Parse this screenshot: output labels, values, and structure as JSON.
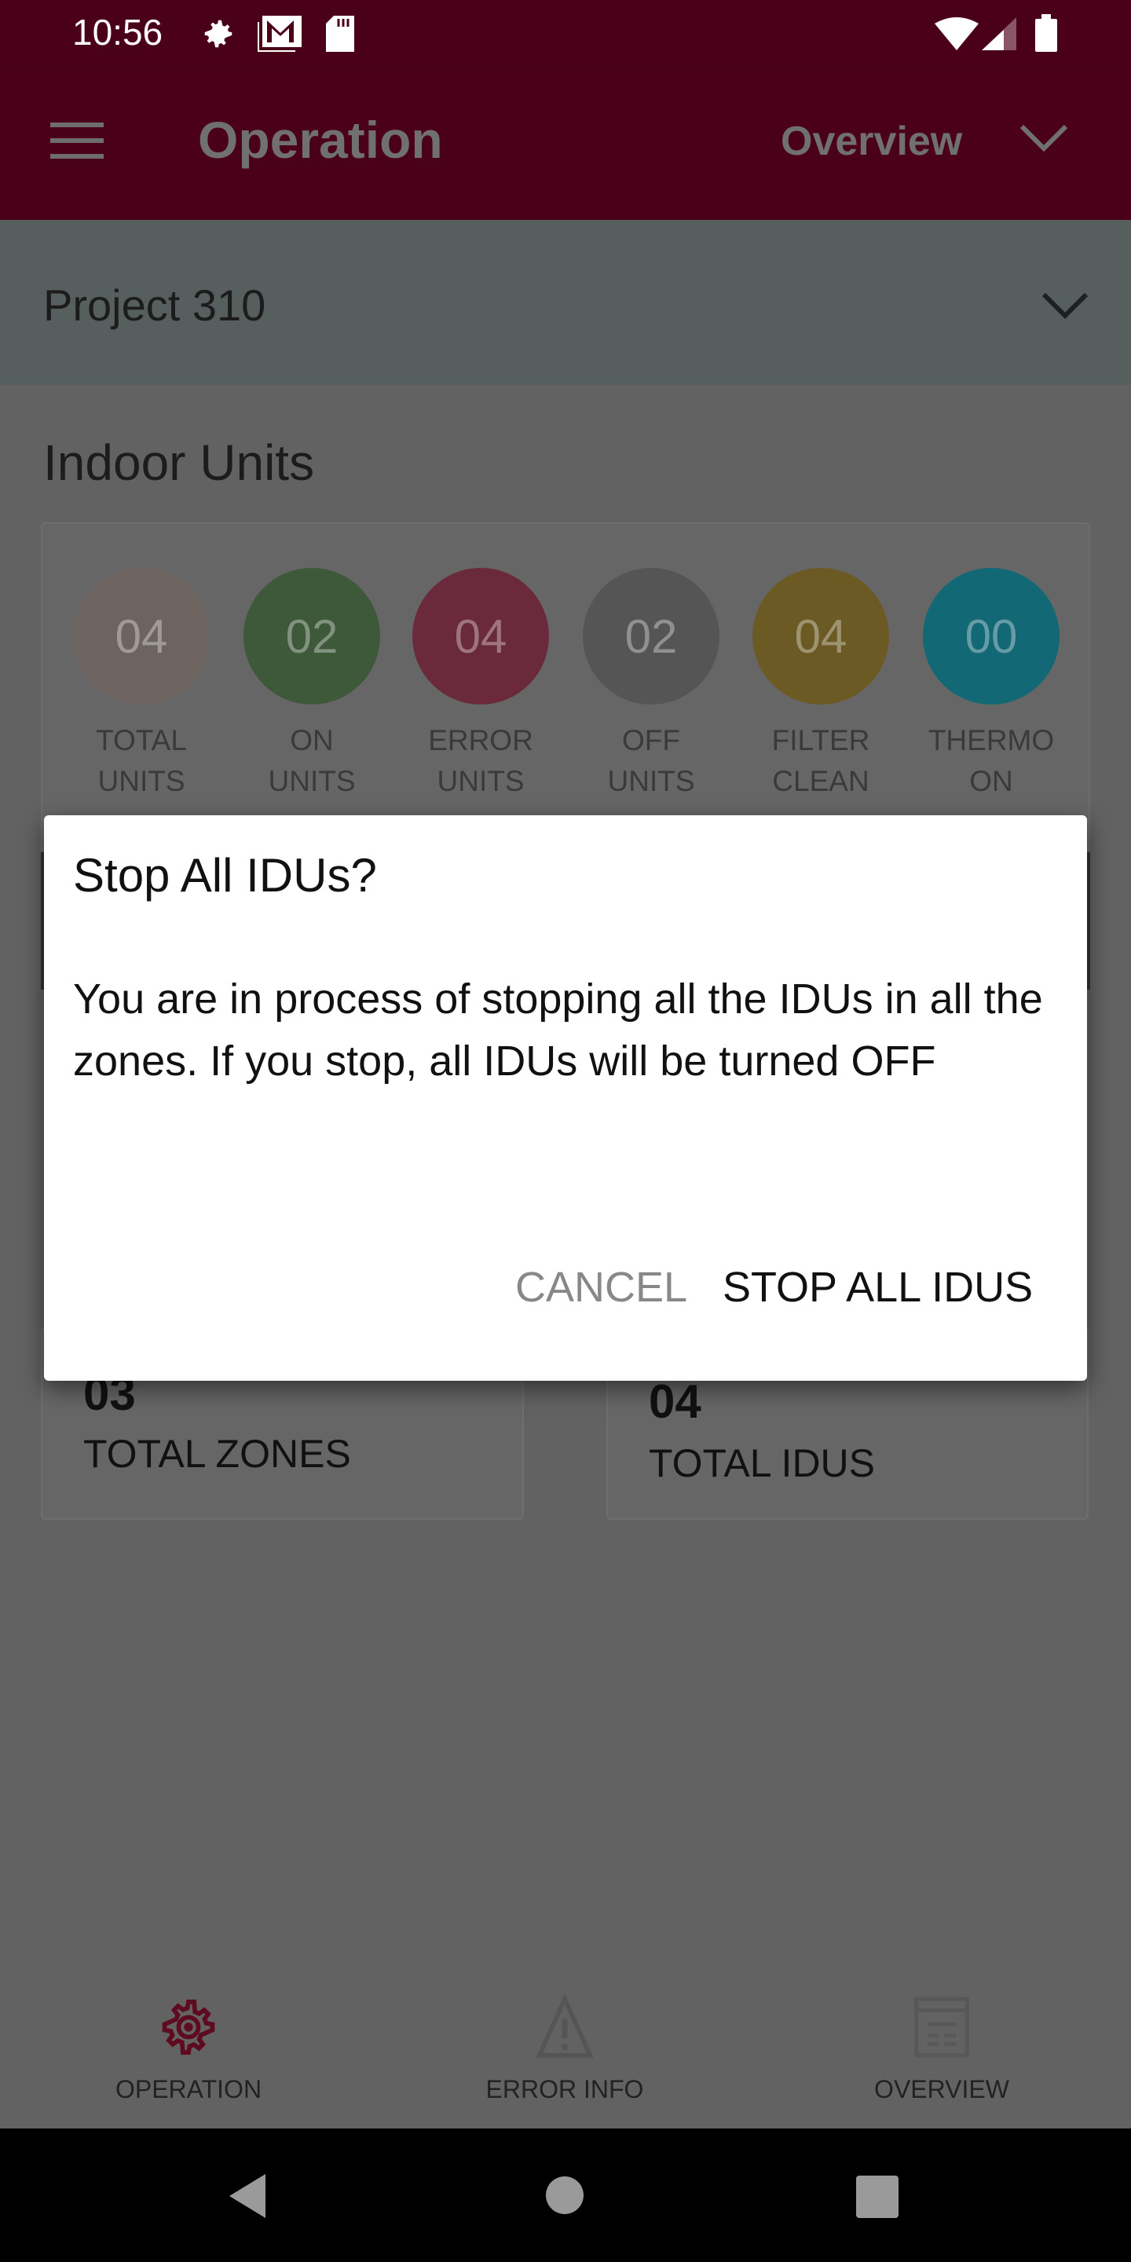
{
  "status_bar": {
    "time": "10:56",
    "icons": [
      "gear-icon",
      "gmail-icon",
      "sd-card-icon",
      "wifi-icon",
      "signal-icon",
      "battery-icon"
    ]
  },
  "app_bar": {
    "title": "Operation",
    "view_selector": "Overview"
  },
  "project_selector": {
    "value": "Project 310"
  },
  "indoor_units": {
    "heading": "Indoor Units",
    "stats": [
      {
        "value": "04",
        "line1": "TOTAL",
        "line2": "UNITS",
        "color": "#6d6460"
      },
      {
        "value": "02",
        "line1": "ON",
        "line2": "UNITS",
        "color": "#3e583a"
      },
      {
        "value": "04",
        "line1": "ERROR",
        "line2": "UNITS",
        "color": "#6b2a3b"
      },
      {
        "value": "02",
        "line1": "OFF",
        "line2": "UNITS",
        "color": "#555555"
      },
      {
        "value": "04",
        "line1": "FILTER",
        "line2": "CLEAN",
        "color": "#6b5a24"
      },
      {
        "value": "00",
        "line1": "THERMO",
        "line2": "ON",
        "color": "#136876"
      }
    ]
  },
  "summary": {
    "zones_value": "03",
    "zones_label": "TOTAL ZONES",
    "idus_value": "04",
    "idus_label": "TOTAL IDUS"
  },
  "dialog": {
    "title": "Stop All IDUs?",
    "message": "You are in process of stopping all the IDUs in all the zones. If you stop, all IDUs will be turned OFF",
    "cancel": "CANCEL",
    "confirm": "STOP ALL IDUS"
  },
  "bottom_nav": {
    "items": [
      {
        "label": "OPERATION",
        "active": true
      },
      {
        "label": "ERROR INFO",
        "active": false
      },
      {
        "label": "OVERVIEW",
        "active": false
      }
    ]
  },
  "colors": {
    "brand": "#a50034",
    "brand_dimmed": "#4b0019"
  }
}
